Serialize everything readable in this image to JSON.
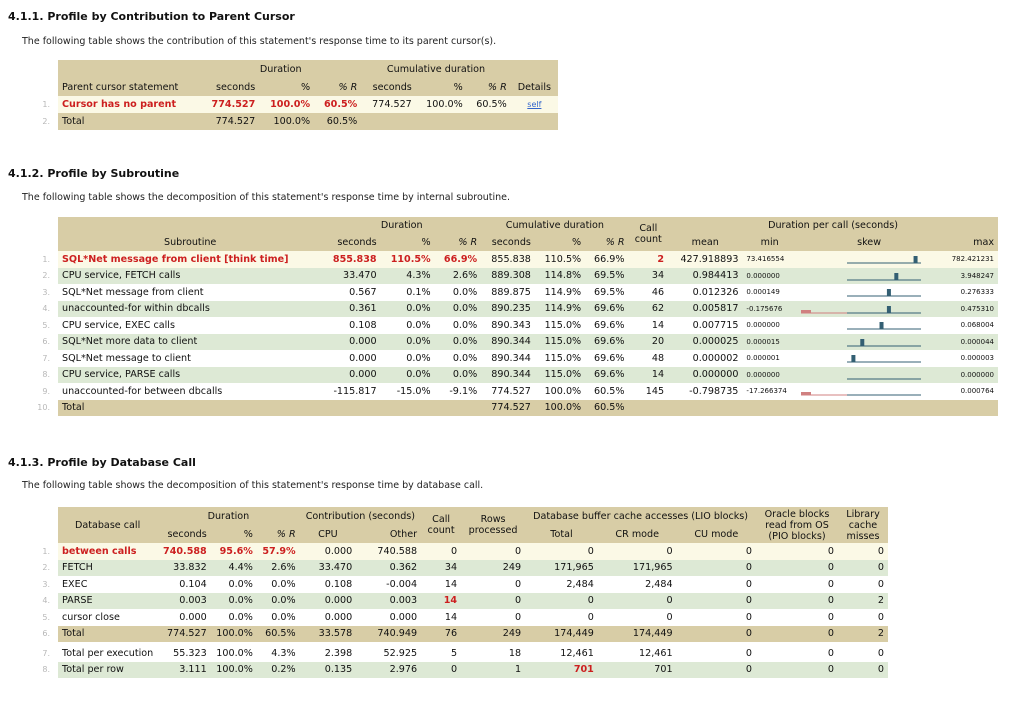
{
  "s1": {
    "heading": "4.1.1. Profile by Contribution to Parent Cursor",
    "desc": "The following table shows the contribution of this statement's response time to its parent cursor(s).",
    "h_duration": "Duration",
    "h_cumulative": "Cumulative duration",
    "cols": [
      "Parent cursor statement",
      "seconds",
      "%",
      "% R",
      "seconds",
      "%",
      "% R",
      "Details"
    ],
    "rows": [
      {
        "n": "1.",
        "name": "Cursor has no parent",
        "s": "774.527",
        "p": "100.0%",
        "r": "60.5%",
        "cs": "774.527",
        "cp": "100.0%",
        "cr": "60.5%",
        "d": "self"
      },
      {
        "n": "2.",
        "name": "Total",
        "s": "774.527",
        "p": "100.0%",
        "r": "60.5%",
        "cs": "",
        "cp": "",
        "cr": "",
        "d": ""
      }
    ]
  },
  "s2": {
    "heading": "4.1.2. Profile by Subroutine",
    "desc": "The following table shows the decomposition of this statement's response time by internal subroutine.",
    "h_duration": "Duration",
    "h_cumulative": "Cumulative duration",
    "h_call": "Call",
    "h_count": "count",
    "h_dpc": "Duration per call (seconds)",
    "cols": [
      "Subroutine",
      "seconds",
      "%",
      "% R",
      "seconds",
      "%",
      "% R",
      "mean",
      "min",
      "skew",
      "max"
    ],
    "rows": [
      {
        "n": "1.",
        "name": "SQL*Net message from client [think time]",
        "s": "855.838",
        "p": "110.5%",
        "r": "66.9%",
        "cs": "855.838",
        "cp": "110.5%",
        "cr": "66.9%",
        "cc": "2",
        "mean": "427.918893",
        "min": "73.416554",
        "max": "782.421231",
        "skew": 0.94,
        "neg": 0
      },
      {
        "n": "2.",
        "name": "CPU service, FETCH calls",
        "s": "33.470",
        "p": "4.3%",
        "r": "2.6%",
        "cs": "889.308",
        "cp": "114.8%",
        "cr": "69.5%",
        "cc": "34",
        "mean": "0.984413",
        "min": "0.000000",
        "max": "3.948247",
        "skew": 0.68,
        "neg": 0
      },
      {
        "n": "3.",
        "name": "SQL*Net message from client",
        "s": "0.567",
        "p": "0.1%",
        "r": "0.0%",
        "cs": "889.875",
        "cp": "114.9%",
        "cr": "69.5%",
        "cc": "46",
        "mean": "0.012326",
        "min": "0.000149",
        "max": "0.276333",
        "skew": 0.58,
        "neg": 0
      },
      {
        "n": "4.",
        "name": "unaccounted-for within dbcalls",
        "s": "0.361",
        "p": "0.0%",
        "r": "0.0%",
        "cs": "890.235",
        "cp": "114.9%",
        "cr": "69.6%",
        "cc": "62",
        "mean": "0.005817",
        "min": "-0.175676",
        "max": "0.475310",
        "skew": 0.58,
        "neg": 1
      },
      {
        "n": "5.",
        "name": "CPU service, EXEC calls",
        "s": "0.108",
        "p": "0.0%",
        "r": "0.0%",
        "cs": "890.343",
        "cp": "115.0%",
        "cr": "69.6%",
        "cc": "14",
        "mean": "0.007715",
        "min": "0.000000",
        "max": "0.068004",
        "skew": 0.48,
        "neg": 0
      },
      {
        "n": "6.",
        "name": "SQL*Net more data to client",
        "s": "0.000",
        "p": "0.0%",
        "r": "0.0%",
        "cs": "890.344",
        "cp": "115.0%",
        "cr": "69.6%",
        "cc": "20",
        "mean": "0.000025",
        "min": "0.000015",
        "max": "0.000044",
        "skew": 0.22,
        "neg": 0
      },
      {
        "n": "7.",
        "name": "SQL*Net message to client",
        "s": "0.000",
        "p": "0.0%",
        "r": "0.0%",
        "cs": "890.344",
        "cp": "115.0%",
        "cr": "69.6%",
        "cc": "48",
        "mean": "0.000002",
        "min": "0.000001",
        "max": "0.000003",
        "skew": 0.1,
        "neg": 0
      },
      {
        "n": "8.",
        "name": "CPU service, PARSE calls",
        "s": "0.000",
        "p": "0.0%",
        "r": "0.0%",
        "cs": "890.344",
        "cp": "115.0%",
        "cr": "69.6%",
        "cc": "14",
        "mean": "0.000000",
        "min": "0.000000",
        "max": "0.000000",
        "skew": -1,
        "neg": 0
      },
      {
        "n": "9.",
        "name": "unaccounted-for between dbcalls",
        "s": "-115.817",
        "p": "-15.0%",
        "r": "-9.1%",
        "cs": "774.527",
        "cp": "100.0%",
        "cr": "60.5%",
        "cc": "145",
        "mean": "-0.798735",
        "min": "-17.266374",
        "max": "0.000764",
        "skew": -1,
        "neg": 2
      },
      {
        "n": "10.",
        "name": "Total",
        "s": "",
        "p": "",
        "r": "",
        "cs": "774.527",
        "cp": "100.0%",
        "cr": "60.5%",
        "cc": "",
        "mean": "",
        "min": "",
        "max": "",
        "skew": -1,
        "neg": 0
      }
    ]
  },
  "s3": {
    "heading": "4.1.3. Profile by Database Call",
    "desc": "The following table shows the decomposition of this statement's response time by database call.",
    "h_dbcall": "Database call",
    "h_duration": "Duration",
    "h_contrib": "Contribution (seconds)",
    "h_callcount": "Call count",
    "h_rows": "Rows processed",
    "h_lio": "Database buffer cache accesses (LIO blocks)",
    "h_pio": "Oracle blocks read from OS (PIO blocks)",
    "h_lib": "Library cache misses",
    "cols": [
      "seconds",
      "%",
      "% R",
      "CPU",
      "Other",
      "Total",
      "CR mode",
      "CU mode"
    ],
    "rows": [
      {
        "n": "1.",
        "name": "between calls",
        "s": "740.588",
        "p": "95.6%",
        "r": "57.9%",
        "cpu": "0.000",
        "oth": "740.588",
        "cc": "0",
        "rp": "0",
        "t": "0",
        "cr": "0",
        "cu": "0",
        "pio": "0",
        "lib": "0"
      },
      {
        "n": "2.",
        "name": "FETCH",
        "s": "33.832",
        "p": "4.4%",
        "r": "2.6%",
        "cpu": "33.470",
        "oth": "0.362",
        "cc": "34",
        "rp": "249",
        "t": "171,965",
        "cr": "171,965",
        "cu": "0",
        "pio": "0",
        "lib": "0"
      },
      {
        "n": "3.",
        "name": "EXEC",
        "s": "0.104",
        "p": "0.0%",
        "r": "0.0%",
        "cpu": "0.108",
        "oth": "-0.004",
        "cc": "14",
        "rp": "0",
        "t": "2,484",
        "cr": "2,484",
        "cu": "0",
        "pio": "0",
        "lib": "0"
      },
      {
        "n": "4.",
        "name": "PARSE",
        "s": "0.003",
        "p": "0.0%",
        "r": "0.0%",
        "cpu": "0.000",
        "oth": "0.003",
        "cc": "14",
        "rp": "0",
        "t": "0",
        "cr": "0",
        "cu": "0",
        "pio": "0",
        "lib": "2"
      },
      {
        "n": "5.",
        "name": "cursor close",
        "s": "0.000",
        "p": "0.0%",
        "r": "0.0%",
        "cpu": "0.000",
        "oth": "0.000",
        "cc": "14",
        "rp": "0",
        "t": "0",
        "cr": "0",
        "cu": "0",
        "pio": "0",
        "lib": "0"
      },
      {
        "n": "6.",
        "name": "Total",
        "s": "774.527",
        "p": "100.0%",
        "r": "60.5%",
        "cpu": "33.578",
        "oth": "740.949",
        "cc": "76",
        "rp": "249",
        "t": "174,449",
        "cr": "174,449",
        "cu": "0",
        "pio": "0",
        "lib": "2"
      },
      {
        "n": "7.",
        "name": "Total per execution",
        "s": "55.323",
        "p": "100.0%",
        "r": "4.3%",
        "cpu": "2.398",
        "oth": "52.925",
        "cc": "5",
        "rp": "18",
        "t": "12,461",
        "cr": "12,461",
        "cu": "0",
        "pio": "0",
        "lib": "0"
      },
      {
        "n": "8.",
        "name": "Total per row",
        "s": "3.111",
        "p": "100.0%",
        "r": "0.2%",
        "cpu": "0.135",
        "oth": "2.976",
        "cc": "0",
        "rp": "1",
        "t": "701",
        "cr": "701",
        "cu": "0",
        "pio": "0",
        "lib": "0"
      }
    ]
  }
}
